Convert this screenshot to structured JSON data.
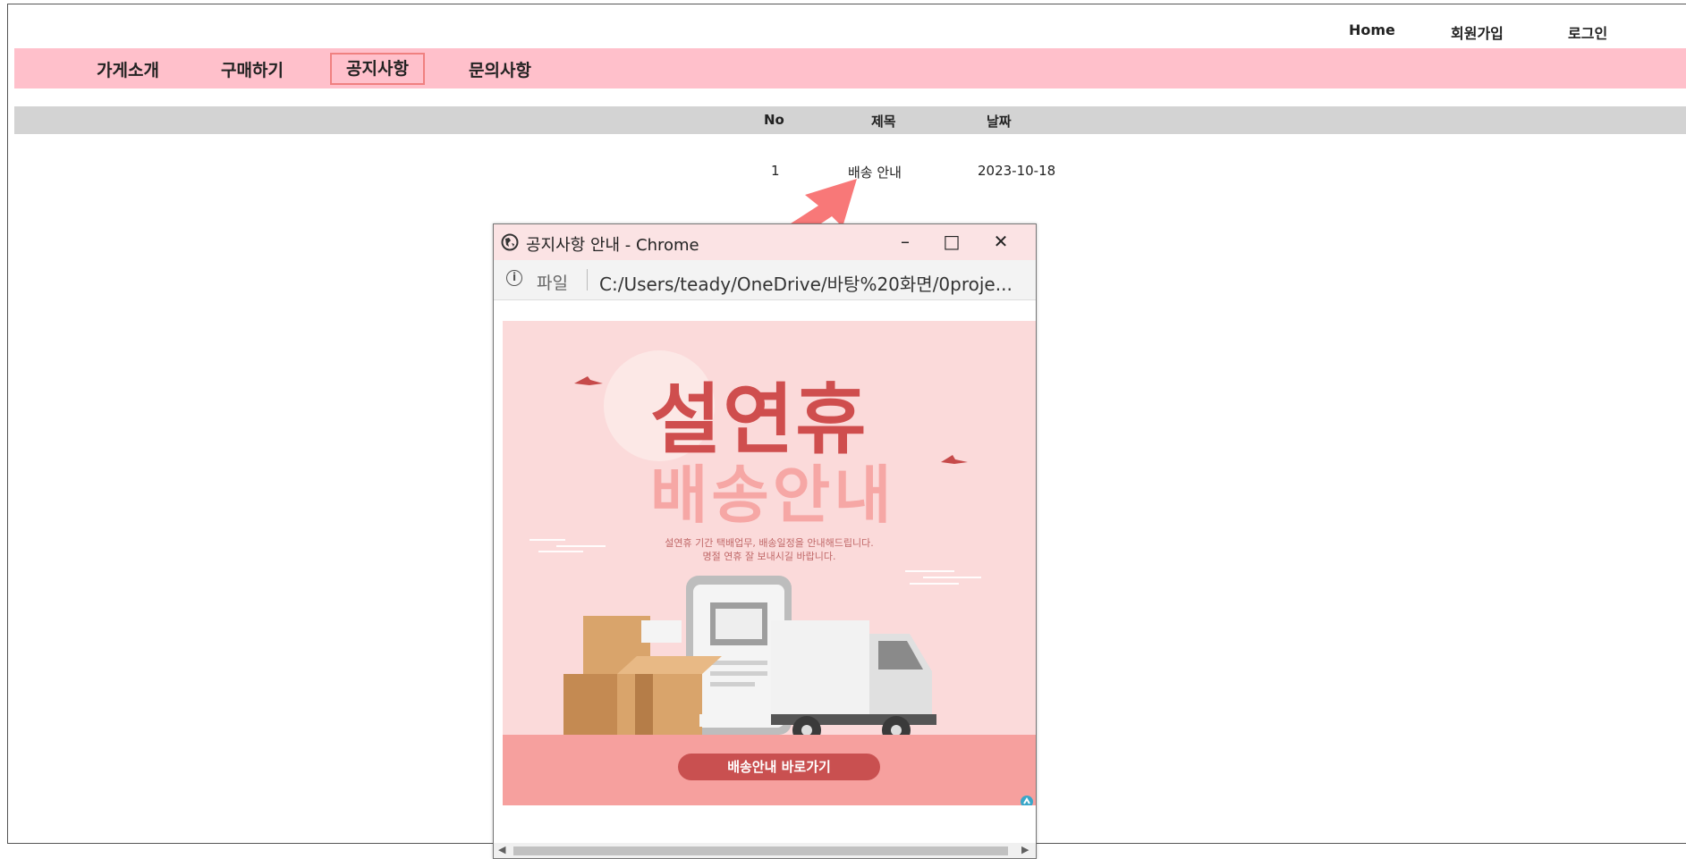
{
  "header": {
    "links": [
      "Home",
      "회원가입",
      "로그인"
    ]
  },
  "nav": {
    "items": [
      "가게소개",
      "구매하기",
      "공지사항",
      "문의사항"
    ],
    "active_index": 2
  },
  "table": {
    "columns": [
      "No",
      "제목",
      "날짜"
    ],
    "rows": [
      {
        "no": "1",
        "title": "배송 안내",
        "date": "2023-10-18"
      }
    ]
  },
  "popup": {
    "title": "공지사항 안내 - Chrome",
    "address_label": "파일",
    "address_url": "C:/Users/teady/OneDrive/바탕%20화면/0proje...",
    "poster": {
      "title": "설연휴",
      "subtitle": "배송안내",
      "description_line1": "설연휴 기간 택배업무, 배송일정을 안내해드립니다.",
      "description_line2": "명절 연휴 잘 보내시길 바랍니다.",
      "button_label": "배송안내 바로가기"
    }
  },
  "colors": {
    "nav_background": "#ffc0cb",
    "active_border": "#f08080",
    "table_header": "#d3d3d3",
    "arrow": "#f87878",
    "poster_title": "#cf4e4e",
    "poster_button": "#c95050"
  }
}
